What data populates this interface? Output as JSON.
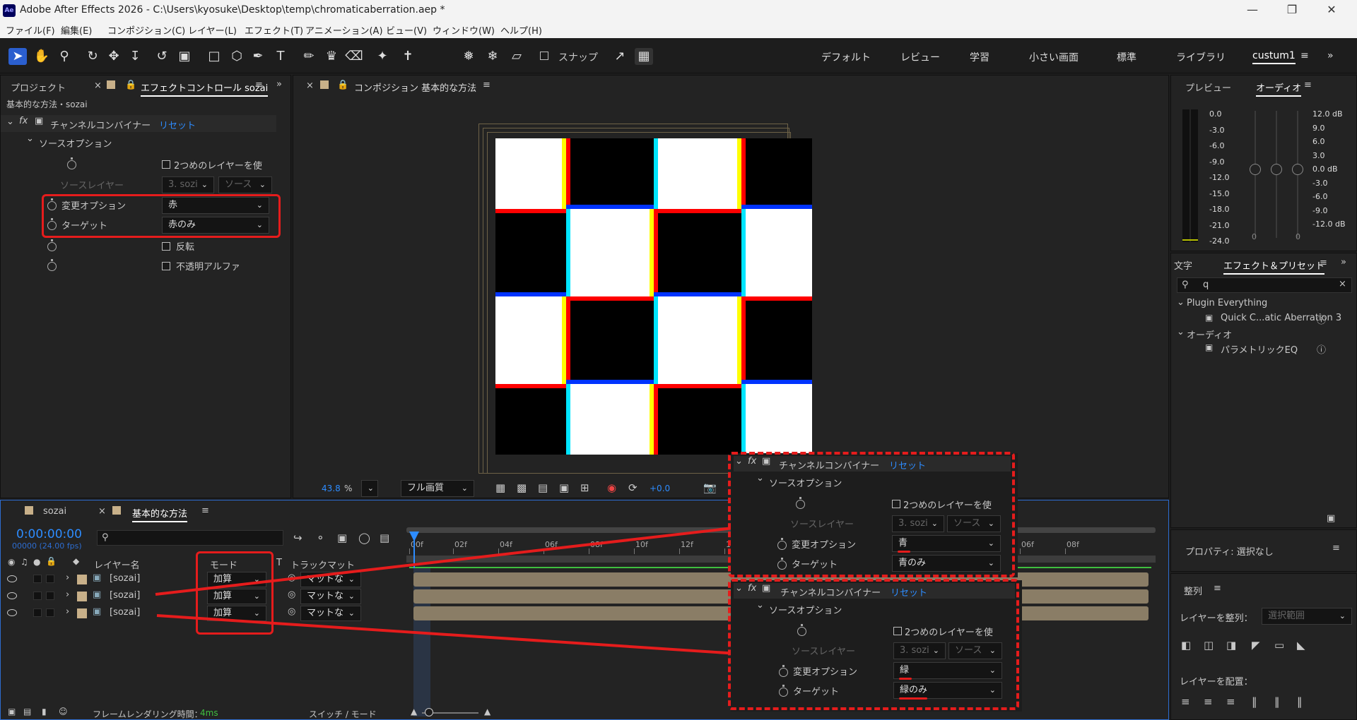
{
  "window": {
    "title": "Adobe After Effects 2026 - C:\\Users\\kyosuke\\Desktop\\temp\\chromaticaberration.aep *",
    "logo": "Ae"
  },
  "menu": [
    "ファイル(F)",
    "編集(E)",
    "コンポジション(C)",
    "レイヤー(L)",
    "エフェクト(T)",
    "アニメーション(A)",
    "ビュー(V)",
    "ウィンドウ(W)",
    "ヘルプ(H)"
  ],
  "toolbar": {
    "snap_label": "スナップ"
  },
  "workspaces": [
    "デフォルト",
    "レビュー",
    "学習",
    "小さい画面",
    "標準",
    "ライブラリ",
    "custum1"
  ],
  "left_panel": {
    "tab_project": "プロジェクト",
    "tab_effects": "エフェクトコントロール sozai",
    "breadcrumb": "基本的な方法・sozai",
    "effect_name": "チャンネルコンバイナー",
    "reset": "リセット",
    "source_options": "ソースオプション",
    "use_second_layer": "2つめのレイヤーを使",
    "source_layer": "ソースレイヤー",
    "source_layer_val": "3. sozi",
    "source_val": "ソース",
    "change_option": "変更オプション",
    "change_option_val": "赤",
    "target": "ターゲット",
    "target_val": "赤のみ",
    "invert": "反転",
    "opaque_alpha": "不透明アルファ"
  },
  "comp_panel": {
    "tab": "コンポジション 基本的な方法",
    "zoom": "43.8",
    "zoom_unit": "%",
    "quality": "フル画質",
    "exposure": "+0.0"
  },
  "right_panel": {
    "tab_preview": "プレビュー",
    "tab_audio": "オーディオ",
    "meter_left": [
      "0.0",
      "-3.0",
      "-6.0",
      "-9.0",
      "-12.0",
      "-15.0",
      "-18.0",
      "-21.0",
      "-24.0"
    ],
    "meter_right": [
      "12.0 dB",
      "9.0",
      "6.0",
      "3.0",
      "0.0 dB",
      "-3.0",
      "-6.0",
      "-9.0",
      "-12.0 dB"
    ],
    "zero_a": "0",
    "zero_b": "0",
    "tab_char": "文字",
    "tab_effects_presets": "エフェクト＆プリセット",
    "search_value": "q",
    "group1": "Plugin Everything",
    "item1": "Quick C...atic Aberration 3",
    "group2": "オーディオ",
    "item2": "パラメトリックEQ",
    "properties": "プロパティ: 選択なし",
    "align": "整列",
    "align_layers_label": "レイヤーを整列：",
    "align_layers_val": "選択範囲",
    "distribute_label": "レイヤーを配置："
  },
  "timeline": {
    "tab_sozai": "sozai",
    "tab_main": "基本的な方法",
    "timecode": "0:00:00:00",
    "timecode_sub": "00000 (24.00 fps)",
    "col_layer_name": "レイヤー名",
    "col_mode": "モード",
    "col_t": "T",
    "col_trackmatte": "トラックマット",
    "ruler": [
      "00f",
      "02f",
      "04f",
      "06f",
      "08f",
      "10f",
      "12f",
      "14f",
      "04f",
      "06f",
      "08f"
    ],
    "layers": [
      {
        "name": "[sozai]",
        "mode": "加算",
        "matte": "マットな"
      },
      {
        "name": "[sozai]",
        "mode": "加算",
        "matte": "マットな"
      },
      {
        "name": "[sozai]",
        "mode": "加算",
        "matte": "マットな"
      }
    ],
    "render_time_label": "フレームレンダリング時間：",
    "render_time_val": "4ms",
    "switch_mode": "スイッチ / モード"
  },
  "callout_blue": {
    "effect_name": "チャンネルコンバイナー",
    "reset": "リセット",
    "source_options": "ソースオプション",
    "use_second_layer": "2つめのレイヤーを使",
    "source_layer": "ソースレイヤー",
    "source_layer_val": "3. sozi",
    "source_val": "ソース",
    "change_option": "変更オプション",
    "change_option_val": "青",
    "target": "ターゲット",
    "target_val": "青のみ"
  },
  "callout_green": {
    "effect_name": "チャンネルコンバイナー",
    "reset": "リセット",
    "source_options": "ソースオプション",
    "use_second_layer": "2つめのレイヤーを使",
    "source_layer": "ソースレイヤー",
    "source_layer_val": "3. sozi",
    "source_val": "ソース",
    "change_option": "変更オプション",
    "change_option_val": "緑",
    "target": "ターゲット",
    "target_val": "緑のみ"
  }
}
